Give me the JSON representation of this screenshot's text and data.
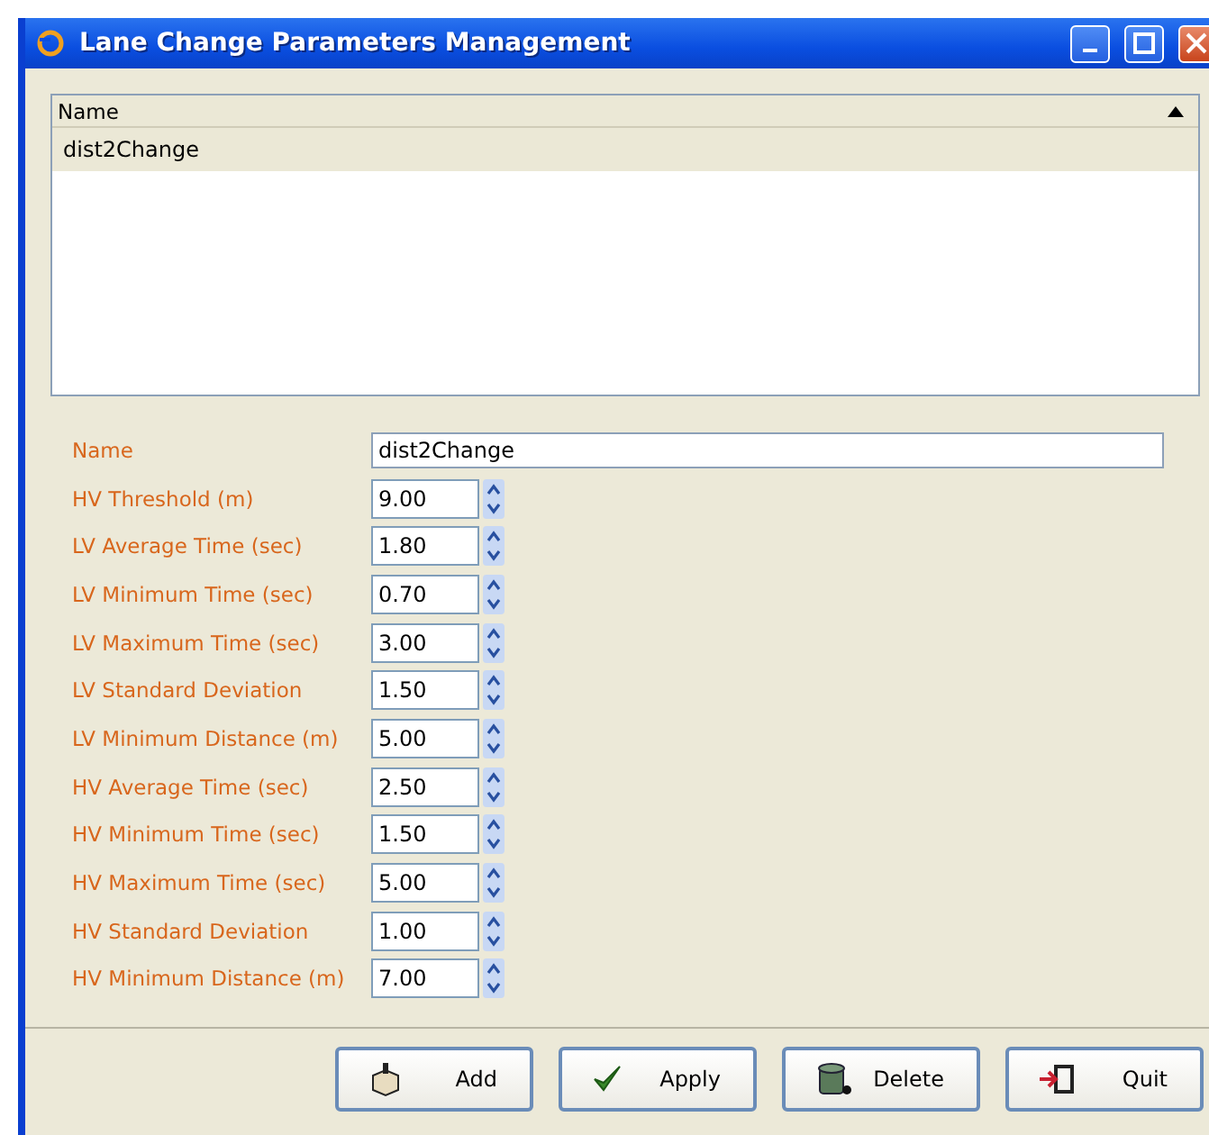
{
  "window": {
    "title": "Lane Change Parameters Management"
  },
  "table": {
    "columns": [
      {
        "label": "Name",
        "sort_ascending": true
      }
    ],
    "rows": [
      {
        "name": "dist2Change",
        "selected": true
      }
    ]
  },
  "form": {
    "name_label": "Name",
    "name_value": "dist2Change",
    "fields": [
      {
        "label": "HV Threshold (m)",
        "value": "9.00"
      },
      {
        "label": "LV Average Time (sec)",
        "value": "1.80"
      },
      {
        "label": "LV Minimum Time (sec)",
        "value": "0.70"
      },
      {
        "label": "LV Maximum Time (sec)",
        "value": "3.00"
      },
      {
        "label": "LV Standard Deviation",
        "value": "1.50"
      },
      {
        "label": "LV Minimum Distance (m)",
        "value": "5.00"
      },
      {
        "label": "HV Average Time (sec)",
        "value": "2.50"
      },
      {
        "label": "HV Minimum Time (sec)",
        "value": "1.50"
      },
      {
        "label": "HV Maximum Time (sec)",
        "value": "5.00"
      },
      {
        "label": "HV Standard Deviation",
        "value": "1.00"
      },
      {
        "label": "HV Minimum Distance (m)",
        "value": "7.00"
      }
    ]
  },
  "buttons": [
    {
      "label": "Add",
      "kind": "add"
    },
    {
      "label": "Apply",
      "kind": "apply"
    },
    {
      "label": "Delete",
      "kind": "delete"
    },
    {
      "label": "Quit",
      "kind": "quit"
    }
  ]
}
